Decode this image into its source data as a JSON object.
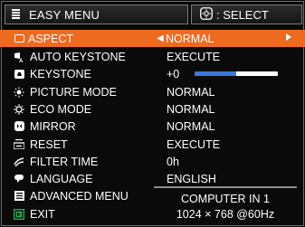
{
  "header": {
    "title": "EASY MENU",
    "select_label": ": SELECT",
    "menu_icon": "menu-icon",
    "select_icon": "select-icon"
  },
  "colors": {
    "highlight": "#ee6a1f",
    "slider_fill": "#3c78d8",
    "background": "#0a0a0a"
  },
  "menu": {
    "items": [
      {
        "label": "ASPECT",
        "value": "NORMAL",
        "icon": "aspect-icon",
        "selected": true
      },
      {
        "label": "AUTO KEYSTONE",
        "value": "EXECUTE",
        "icon": "auto-keystone-icon"
      },
      {
        "label": "KEYSTONE",
        "value": "+0",
        "icon": "keystone-icon",
        "slider_fraction": 0.5
      },
      {
        "label": "PICTURE MODE",
        "value": "NORMAL",
        "icon": "picture-mode-icon"
      },
      {
        "label": "ECO MODE",
        "value": "NORMAL",
        "icon": "eco-mode-icon"
      },
      {
        "label": "MIRROR",
        "value": "NORMAL",
        "icon": "mirror-icon"
      },
      {
        "label": "RESET",
        "value": "EXECUTE",
        "icon": "reset-icon"
      },
      {
        "label": "FILTER TIME",
        "value": "0h",
        "icon": "filter-time-icon"
      },
      {
        "label": "LANGUAGE",
        "value": "ENGLISH",
        "icon": "language-icon"
      },
      {
        "label": "ADVANCED MENU",
        "icon": "advanced-menu-icon"
      },
      {
        "label": "EXIT",
        "icon": "exit-icon"
      }
    ]
  },
  "input": {
    "source": "COMPUTER IN 1",
    "signal": "1024 × 768 @60Hz"
  }
}
